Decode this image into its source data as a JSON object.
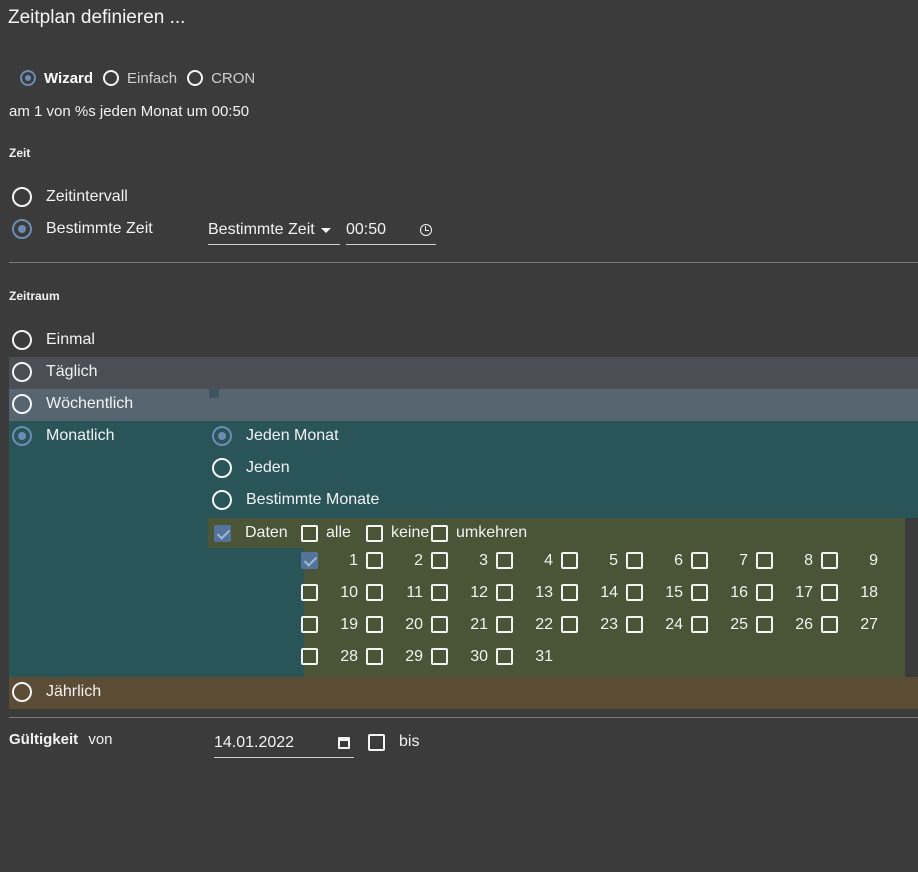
{
  "title": "Zeitplan definieren ...",
  "mode": {
    "wizard": "Wizard",
    "simple": "Einfach",
    "cron": "CRON"
  },
  "summary": "am 1 von %s jeden Monat um 00:50",
  "time_section": {
    "heading": "Zeit",
    "interval": "Zeitintervall",
    "specific": "Bestimmte Zeit",
    "select_value": "Bestimmte Zeit",
    "time_value": "00:50"
  },
  "range_section": {
    "heading": "Zeitraum",
    "once": "Einmal",
    "daily": "Täglich",
    "weekly": "Wöchentlich",
    "monthly": "Monatlich",
    "yearly": "Jährlich"
  },
  "monthly": {
    "every_month": "Jeden Monat",
    "every": "Jeden",
    "specific_months": "Bestimmte Monate",
    "dates": "Daten",
    "all": "alle",
    "none": "keine",
    "invert": "umkehren",
    "days": [
      "1",
      "2",
      "3",
      "4",
      "5",
      "6",
      "7",
      "8",
      "9",
      "10",
      "11",
      "12",
      "13",
      "14",
      "15",
      "16",
      "17",
      "18",
      "19",
      "20",
      "21",
      "22",
      "23",
      "24",
      "25",
      "26",
      "27",
      "28",
      "29",
      "30",
      "31"
    ],
    "checked_days": [
      "1"
    ]
  },
  "validity": {
    "label": "Gültigkeit",
    "from": "von",
    "from_date": "14.01.2022",
    "to": "bis"
  },
  "colors": {
    "background": "#3b3b3b",
    "daily_band": "#4b4f55",
    "weekly_band": "#566570",
    "monthly_band": "#2a5558",
    "dates_band": "#4a5436",
    "yearly_band": "#5b4c36",
    "accent": "#6b8db5"
  }
}
